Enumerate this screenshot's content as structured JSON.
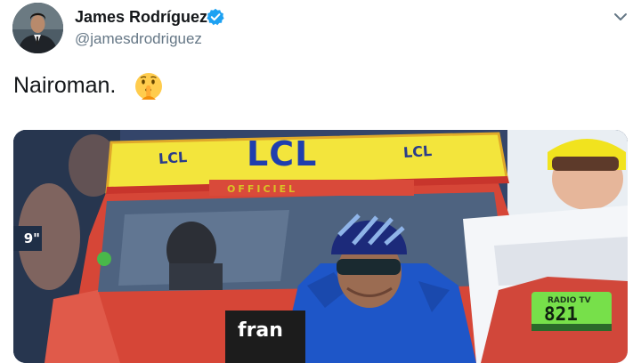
{
  "author": {
    "display_name": "James Rodríguez",
    "handle": "@jamesdrodriguez",
    "verified": true
  },
  "tweet": {
    "text": "Nairoman.",
    "emoji": "shushing-face-emoji"
  },
  "media": {
    "sign_main": "LCL",
    "sign_small_left": "LCL",
    "sign_small_right": "LCL",
    "sign_official": "OFFICIEL",
    "time_fragment": "9\"",
    "radio_label": "RADIO TV",
    "radio_number": "821",
    "sponsor_fragment": "fran"
  },
  "icons": {
    "verified": "verified-badge-icon",
    "menu": "chevron-down-icon"
  },
  "colors": {
    "name": "#14171a",
    "handle": "#657786",
    "verified": "#1da1f2",
    "jersey": "#1e56c8",
    "sign_yellow": "#f3e53c"
  }
}
